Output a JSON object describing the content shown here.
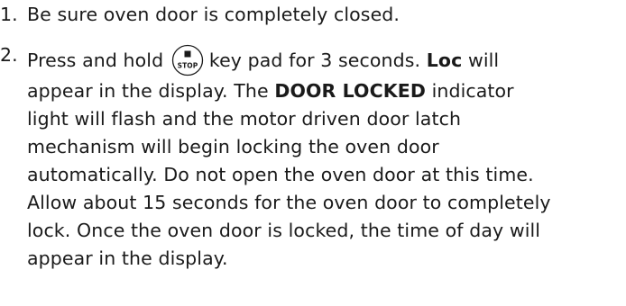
{
  "steps": [
    {
      "number": "1.",
      "text": "Be sure oven door is completely closed."
    },
    {
      "number": "2.",
      "line1_before": "Press and hold",
      "key_label": "STOP",
      "line1_after": "key pad for 3 seconds.",
      "bold_loc": "Loc",
      "line1_end": "will",
      "line2_before": "appear in the display. The",
      "bold_door_locked": "DOOR LOCKED",
      "line2_after": "indicator",
      "line3": "light will flash and the motor driven door latch",
      "line4": "mechanism will begin locking the oven door",
      "line5": "automatically. Do not open the oven door at this time.",
      "line6": "Allow about 15 seconds for the oven door to completely",
      "line7": "lock. Once the oven door is locked, the time of day will",
      "line8": "appear in the display."
    }
  ],
  "icons": {
    "stop_key": "stop-key-icon"
  },
  "colors": {
    "text": "#1a1a1a",
    "background": "#ffffff"
  }
}
